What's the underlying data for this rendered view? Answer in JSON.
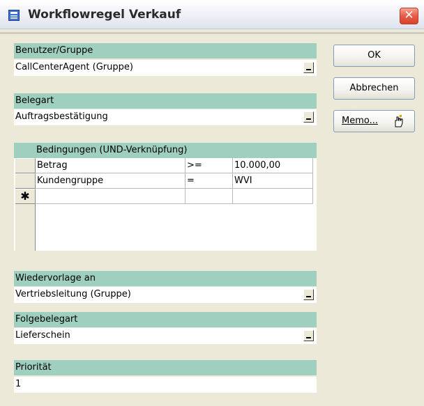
{
  "window": {
    "title": "Workflowregel Verkauf",
    "close_glyph": "✕"
  },
  "fields": {
    "benutzer": {
      "label": "Benutzer/Gruppe",
      "value": "CallCenterAgent (Gruppe)"
    },
    "belegart": {
      "label": "Belegart",
      "value": "Auftragsbestätigung"
    },
    "wiedervorlage": {
      "label": "Wiedervorlage an",
      "value": "Vertriebsleitung (Gruppe)"
    },
    "folgebelegart": {
      "label": "Folgebelegart",
      "value": "Lieferschein"
    },
    "prioritaet": {
      "label": "Priorität",
      "value": "1"
    }
  },
  "conditions": {
    "header": "Bedingungen (UND-Verknüpfung)",
    "new_row_marker": "✱",
    "rows": [
      {
        "field": "Betrag",
        "operator": ">=",
        "value": "10.000,00"
      },
      {
        "field": "Kundengruppe",
        "operator": "=",
        "value": "WVI"
      }
    ]
  },
  "buttons": {
    "ok": "OK",
    "cancel": "Abbrechen",
    "memo": "Memo..."
  },
  "icons": {
    "window_icon": "form-icon",
    "close": "close-icon",
    "memo": "hand-pointer-icon",
    "dropdown": "dropdown-arrow-icon"
  },
  "colors": {
    "label_bar": "#9fcfbf",
    "dialog_bg": "#ece9d8",
    "close_button": "#e0533d"
  }
}
